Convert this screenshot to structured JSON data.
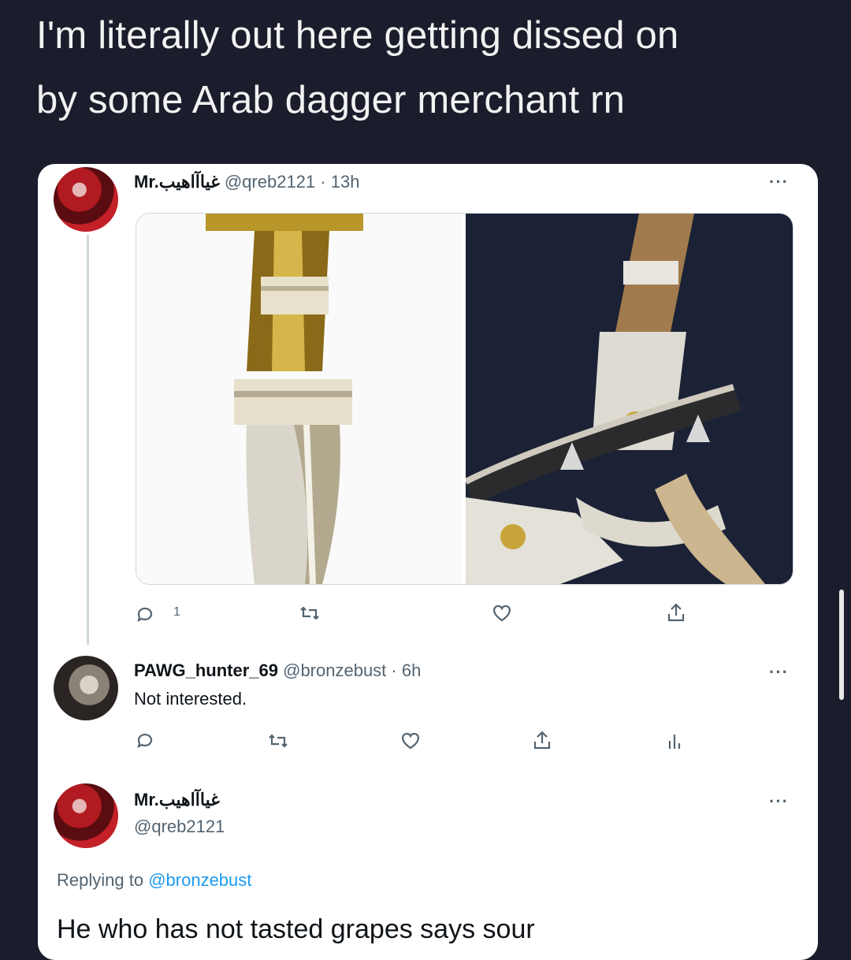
{
  "caption": {
    "line1": "I'm literally out here getting dissed on",
    "line2": "by some Arab dagger merchant rn"
  },
  "tweet1": {
    "display_name": "Mr.غياآاهيب",
    "handle": "@qreb2121",
    "time": "· 13h",
    "more": "···",
    "reply_count": "1",
    "media": [
      "dagger-handle-closeup",
      "dagger-with-belt"
    ]
  },
  "tweet2": {
    "display_name": "PAWG_hunter_69",
    "handle": "@bronzebust",
    "time": "· 6h",
    "text": "Not interested.",
    "more": "···"
  },
  "tweet3": {
    "display_name": "Mr.غياآاهيب",
    "handle": "@qreb2121",
    "more": "···",
    "replying_prefix": "Replying to",
    "replying_handle": "@bronzebust",
    "text": "He who has not tasted grapes says sour"
  },
  "icons": [
    "reply-icon",
    "retweet-icon",
    "like-icon",
    "share-icon",
    "analytics-icon",
    "more-icon"
  ],
  "colors": {
    "background": "#1b1d2c",
    "card": "#ffffff",
    "link": "#1d9bf0",
    "muted": "#536471"
  }
}
